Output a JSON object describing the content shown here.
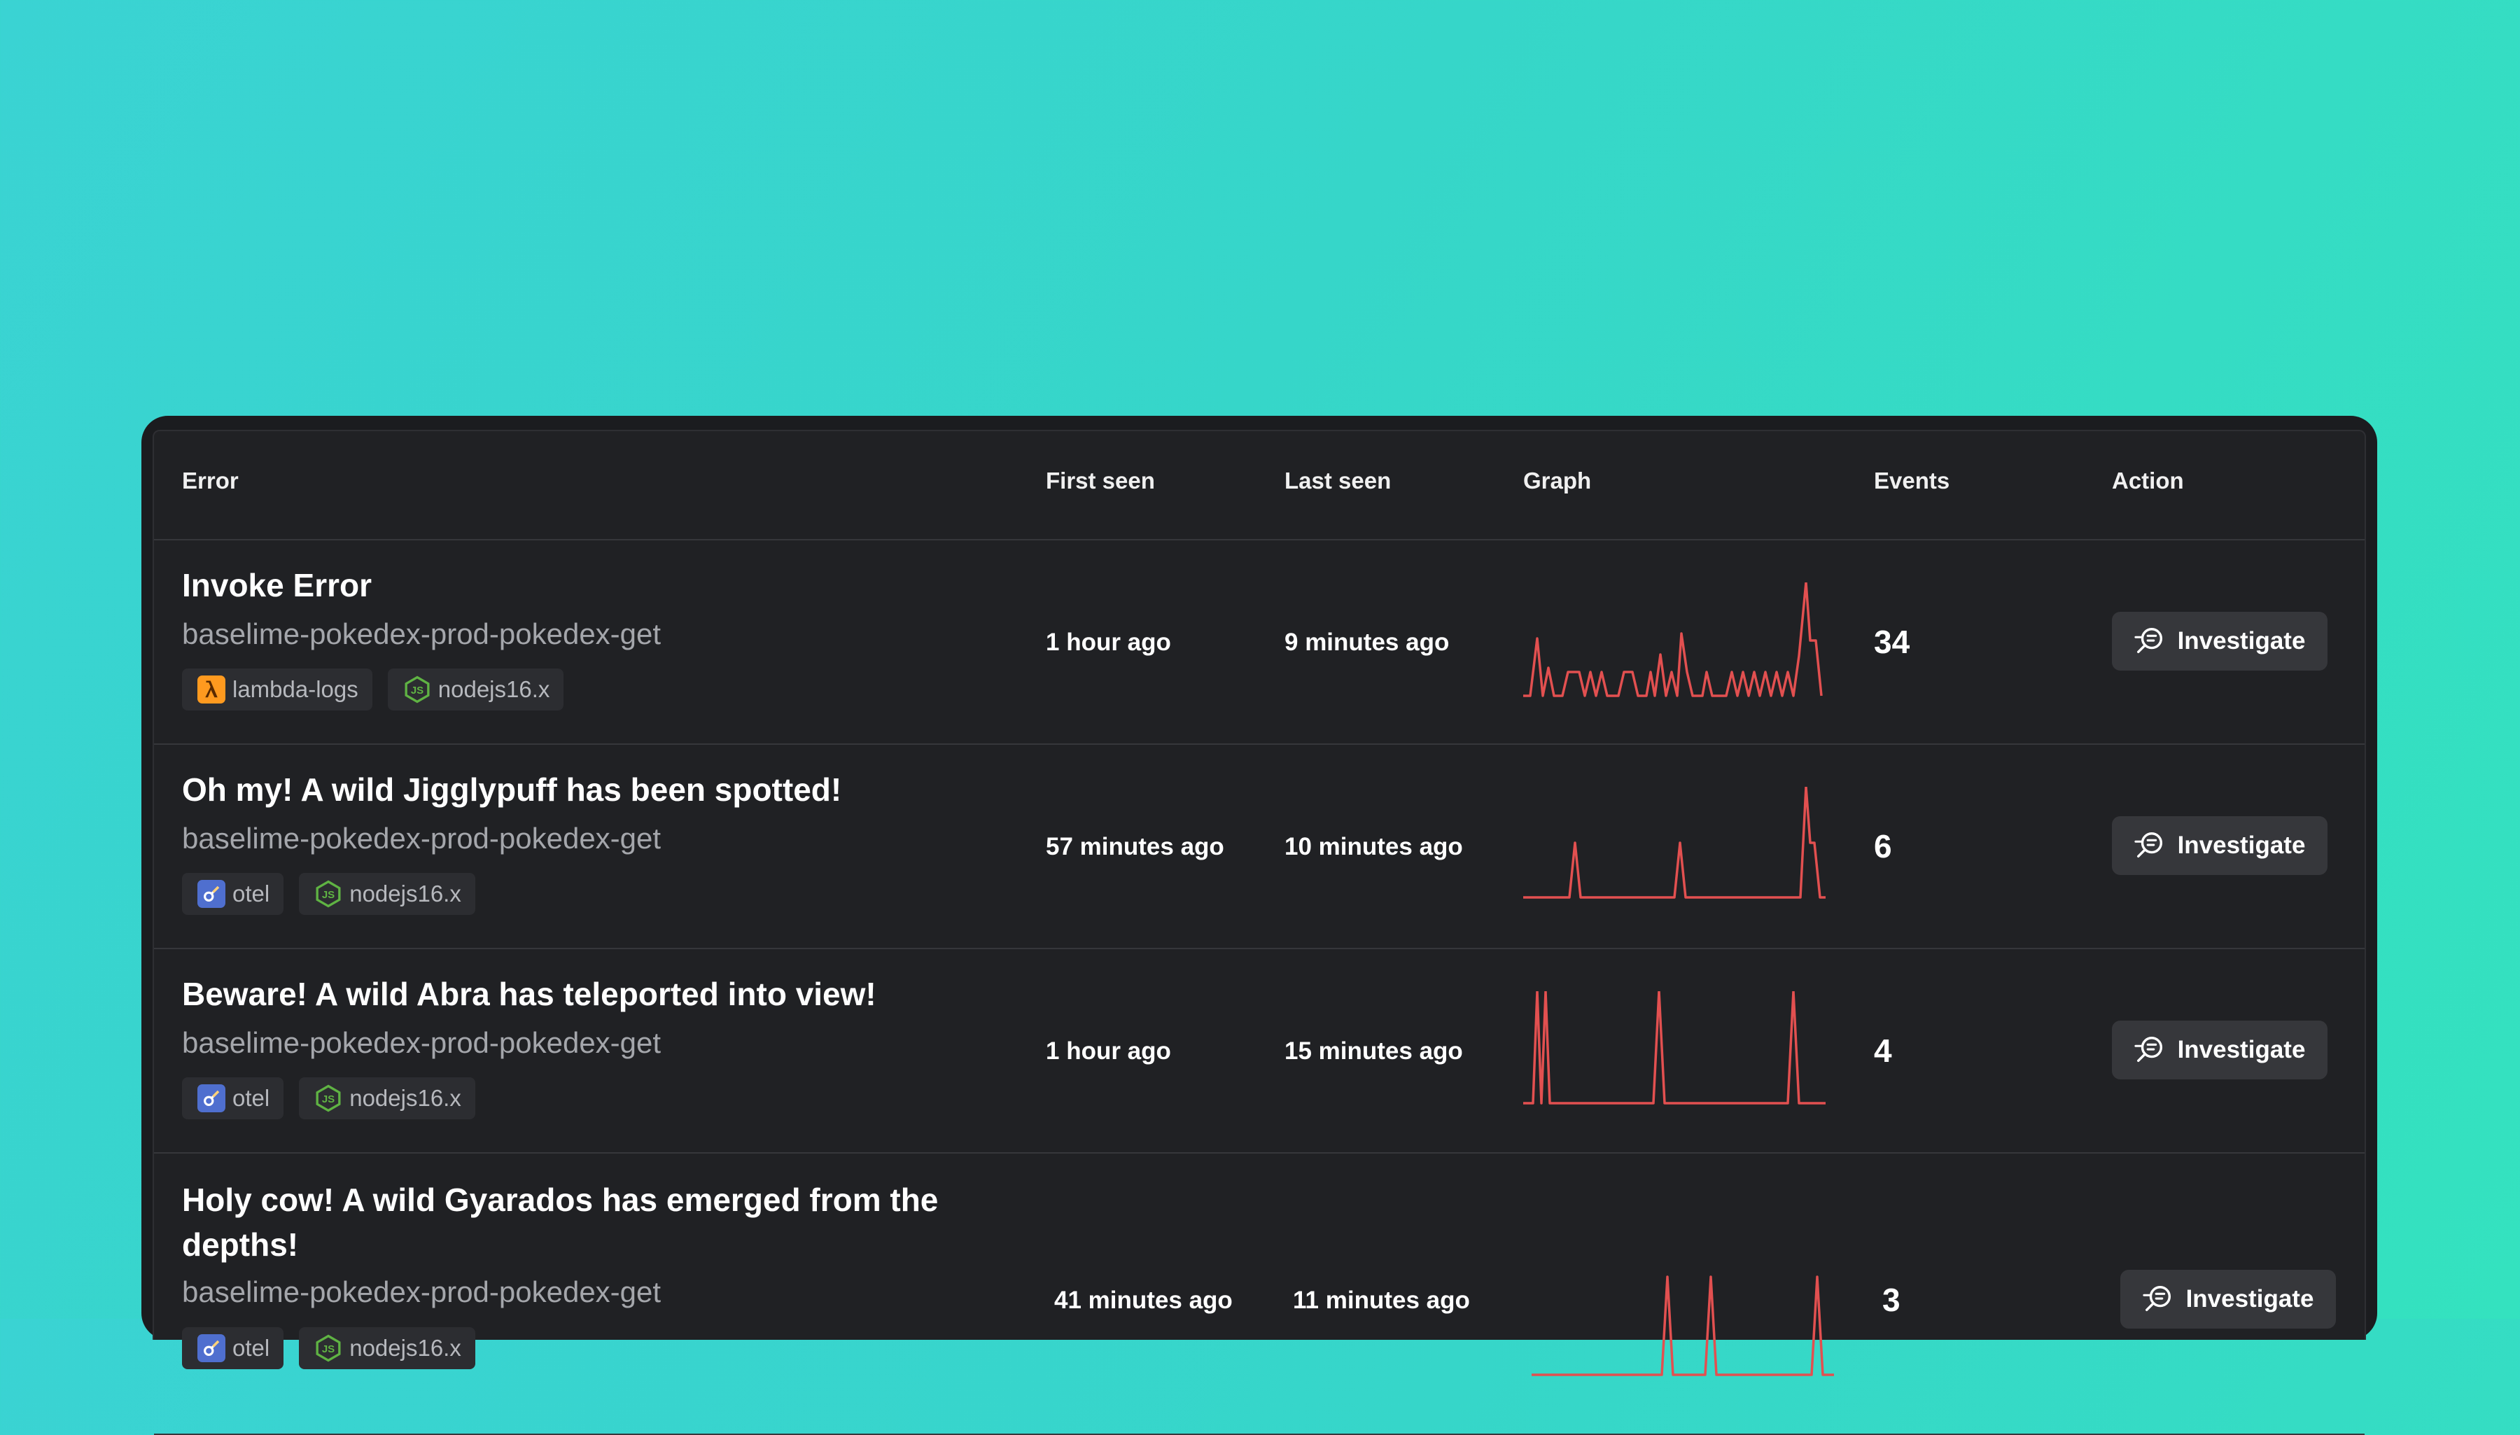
{
  "columns": {
    "error": "Error",
    "first_seen": "First seen",
    "last_seen": "Last seen",
    "graph": "Graph",
    "events": "Events",
    "action": "Action"
  },
  "rows": [
    {
      "title": "Invoke Error",
      "service": "baselime-pokedex-prod-pokedex-get",
      "tags": [
        {
          "label": "lambda-logs",
          "icon": "aws-lambda-icon",
          "color": "#ff9a1f"
        },
        {
          "label": "nodejs16.x",
          "icon": "nodejs-icon",
          "color": "#5fb343"
        }
      ],
      "first_seen": "1 hour ago",
      "last_seen": "9 minutes ago",
      "events": "34",
      "action": "Investigate",
      "graph": [
        0,
        0,
        0,
        0,
        0,
        0,
        0,
        0,
        0,
        0,
        0,
        0,
        0,
        0,
        0,
        0,
        0,
        0,
        0,
        0,
        0,
        0,
        0,
        0,
        0,
        0,
        0,
        0,
        0,
        0,
        0,
        0,
        0,
        0,
        0,
        0,
        0,
        0,
        0,
        0,
        0,
        0,
        0,
        0,
        0,
        0,
        0,
        0,
        0,
        0
      ]
    },
    {
      "title": "Oh my! A wild Jigglypuff has been spotted!",
      "service": "baselime-pokedex-prod-pokedex-get",
      "tags": [
        {
          "label": "otel",
          "icon": "otel-icon",
          "color": "#4f6fcf"
        },
        {
          "label": "nodejs16.x",
          "icon": "nodejs-icon",
          "color": "#5fb343"
        }
      ],
      "first_seen": "57 minutes ago",
      "last_seen": "10 minutes ago",
      "events": "6",
      "action": "Investigate"
    },
    {
      "title": "Beware! A wild Abra has teleported into view!",
      "service": "baselime-pokedex-prod-pokedex-get",
      "tags": [
        {
          "label": "otel",
          "icon": "otel-icon",
          "color": "#4f6fcf"
        },
        {
          "label": "nodejs16.x",
          "icon": "nodejs-icon",
          "color": "#5fb343"
        }
      ],
      "first_seen": "1 hour ago",
      "last_seen": "15 minutes ago",
      "events": "4",
      "action": "Investigate"
    },
    {
      "title": "Holy cow! A wild Gyarados has emerged from the depths!",
      "service": "baselime-pokedex-prod-pokedex-get",
      "tags": [
        {
          "label": "otel",
          "icon": "otel-icon",
          "color": "#4f6fcf"
        },
        {
          "label": "nodejs16.x",
          "icon": "nodejs-icon",
          "color": "#5fb343"
        }
      ],
      "first_seen": "41 minutes ago",
      "last_seen": "11 minutes ago",
      "events": "3",
      "action": "Investigate"
    }
  ],
  "colors": {
    "sparkline": "#e25050",
    "background_start": "#3ad3d3",
    "background_end": "#34e2bf",
    "panel": "#202124"
  }
}
